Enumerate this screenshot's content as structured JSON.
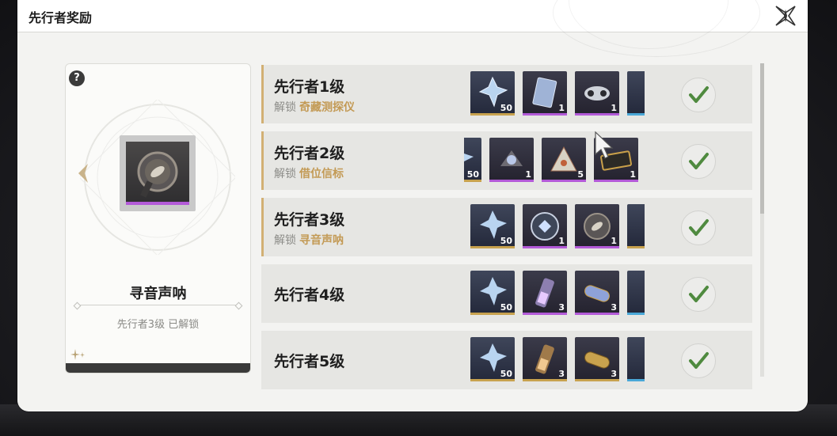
{
  "window": {
    "title": "先行者奖励",
    "close_icon": "close-star-icon"
  },
  "card": {
    "help_label": "?",
    "item_name": "寻音声呐",
    "status": "先行者3级 已解锁",
    "prev_icon": "chevron-left-icon"
  },
  "rows": [
    {
      "title": "先行者1级",
      "unlock_prefix": "解锁",
      "unlock_name": "奇藏测探仪",
      "rewards": [
        {
          "icon": "crystal-icon",
          "count": "50",
          "rarity": "gold"
        },
        {
          "icon": "card-icon",
          "count": "1",
          "rarity": "purple"
        },
        {
          "icon": "drone-icon",
          "count": "1",
          "rarity": "purple"
        },
        {
          "icon": "partial-item-icon",
          "count": "",
          "rarity": "blue"
        }
      ],
      "claimed": true
    },
    {
      "title": "先行者2级",
      "unlock_prefix": "解锁",
      "unlock_name": "借位信标",
      "rewards": [
        {
          "icon": "crystal-icon",
          "count": "50",
          "rarity": "gold"
        },
        {
          "icon": "beacon-icon",
          "count": "1",
          "rarity": "purple"
        },
        {
          "icon": "chip-icon",
          "count": "5",
          "rarity": "purple"
        },
        {
          "icon": "ticket-icon",
          "count": "1",
          "rarity": "purple"
        }
      ],
      "claimed": true
    },
    {
      "title": "先行者3级",
      "unlock_prefix": "解锁",
      "unlock_name": "寻音声呐",
      "rewards": [
        {
          "icon": "crystal-icon",
          "count": "50",
          "rarity": "gold"
        },
        {
          "icon": "sonar-disk-icon",
          "count": "1",
          "rarity": "purple"
        },
        {
          "icon": "sonar-device-icon",
          "count": "1",
          "rarity": "purple"
        },
        {
          "icon": "partial-item-icon",
          "count": "",
          "rarity": "gold"
        }
      ],
      "claimed": true
    },
    {
      "title": "先行者4级",
      "unlock_prefix": "",
      "unlock_name": "",
      "rewards": [
        {
          "icon": "crystal-icon",
          "count": "50",
          "rarity": "gold"
        },
        {
          "icon": "vial-icon",
          "count": "3",
          "rarity": "purple"
        },
        {
          "icon": "capsule-icon",
          "count": "3",
          "rarity": "purple"
        },
        {
          "icon": "partial-item-icon",
          "count": "",
          "rarity": "blue"
        }
      ],
      "claimed": true
    },
    {
      "title": "先行者5级",
      "unlock_prefix": "",
      "unlock_name": "",
      "rewards": [
        {
          "icon": "crystal-icon",
          "count": "50",
          "rarity": "gold"
        },
        {
          "icon": "vial-icon",
          "count": "3",
          "rarity": "gold"
        },
        {
          "icon": "capsule-icon",
          "count": "3",
          "rarity": "gold"
        },
        {
          "icon": "partial-item-icon",
          "count": "",
          "rarity": "blue"
        }
      ],
      "claimed": true
    }
  ],
  "colors": {
    "accent": "#d2b074",
    "highlight_text": "#c39a55",
    "check": "#4f8a3f",
    "purple": "#b35ad8",
    "gold": "#c8a24e",
    "blue": "#4aa8d8"
  }
}
